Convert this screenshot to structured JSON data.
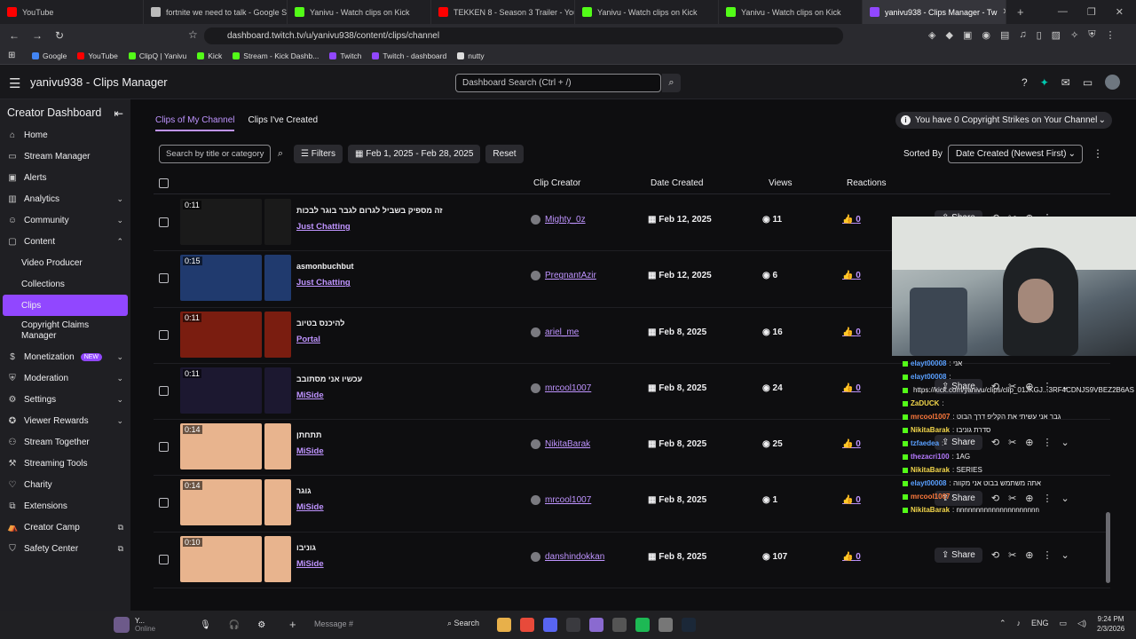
{
  "browser": {
    "tabs": [
      {
        "label": "YouTube",
        "color": "#ff0000"
      },
      {
        "label": "fortnite we need to talk - Google Se",
        "color": "#bbbbbb"
      },
      {
        "label": "Yanivu - Watch clips on Kick",
        "color": "#53fc18"
      },
      {
        "label": "TEKKEN 8 - Season 3 Trailer - YouTu",
        "color": "#ff0000"
      },
      {
        "label": "Yanivu - Watch clips on Kick",
        "color": "#53fc18"
      },
      {
        "label": "Yanivu - Watch clips on Kick",
        "color": "#53fc18"
      },
      {
        "label": "yanivu938 - Clips Manager - Tw",
        "color": "#9147ff"
      }
    ],
    "url": "dashboard.twitch.tv/u/yanivu938/content/clips/channel",
    "bookmarks": [
      {
        "label": "Google",
        "color": "#4285f4"
      },
      {
        "label": "YouTube",
        "color": "#ff0000"
      },
      {
        "label": "ClipQ | Yanivu",
        "color": "#53fc18"
      },
      {
        "label": "Kick",
        "color": "#53fc18"
      },
      {
        "label": "Stream - Kick Dashb...",
        "color": "#53fc18"
      },
      {
        "label": "Twitch",
        "color": "#9147ff"
      },
      {
        "label": "Twitch - dashboard",
        "color": "#9147ff"
      },
      {
        "label": "nutty",
        "color": "#dddddd"
      }
    ]
  },
  "header": {
    "title": "yanivu938 - Clips Manager",
    "search_placeholder": "Dashboard Search (Ctrl + /)"
  },
  "sidebar": {
    "title": "Creator Dashboard",
    "items": [
      {
        "label": "Home",
        "icon": "⌂"
      },
      {
        "label": "Stream Manager",
        "icon": "▭"
      },
      {
        "label": "Alerts",
        "icon": "▣"
      },
      {
        "label": "Analytics",
        "icon": "▥",
        "chev": "⌄"
      },
      {
        "label": "Community",
        "icon": "☺",
        "chev": "⌄"
      },
      {
        "label": "Content",
        "icon": "▢",
        "chev": "⌃"
      }
    ],
    "content_sub": [
      {
        "label": "Video Producer"
      },
      {
        "label": "Collections"
      },
      {
        "label": "Clips"
      },
      {
        "label": "Copyright Claims Manager"
      }
    ],
    "items2": [
      {
        "label": "Monetization",
        "icon": "$",
        "chev": "⌄",
        "badge": "NEW"
      },
      {
        "label": "Moderation",
        "icon": "⛨",
        "chev": "⌄"
      },
      {
        "label": "Settings",
        "icon": "⚙",
        "chev": "⌄"
      },
      {
        "label": "Viewer Rewards",
        "icon": "✪",
        "chev": "⌄"
      },
      {
        "label": "Stream Together",
        "icon": "⚇"
      },
      {
        "label": "Streaming Tools",
        "icon": "⚒"
      },
      {
        "label": "Charity",
        "icon": "♡"
      },
      {
        "label": "Extensions",
        "icon": "⧉"
      },
      {
        "label": "Creator Camp",
        "icon": "⛺",
        "ext": "⧉"
      },
      {
        "label": "Safety Center",
        "icon": "⛉",
        "ext": "⧉"
      }
    ]
  },
  "main": {
    "tabs": [
      "Clips of My Channel",
      "Clips I've Created"
    ],
    "strikes": "You have 0 Copyright Strikes on Your Channel",
    "search_placeholder": "Search by title or category",
    "filters": "Filters",
    "date_range": "Feb 1, 2025 - Feb 28, 2025",
    "reset": "Reset",
    "sorted_by": "Sorted By",
    "sort_value": "Date Created (Newest First)",
    "columns": {
      "creator": "Clip Creator",
      "date": "Date Created",
      "views": "Views",
      "reactions": "Reactions"
    },
    "share_label": "Share",
    "clips": [
      {
        "duration": "0:11",
        "title": "זה מספיק בשביל לגרום לגבר בוגר לבכות",
        "category": "Just Chatting",
        "creator": "Mighty_0z",
        "date": "Feb 12, 2025",
        "views": "11",
        "reactions": "0",
        "thumb": "#1a1a1a"
      },
      {
        "duration": "0:15",
        "title": "asmonbuchbut",
        "category": "Just Chatting",
        "creator": "PregnantAzir",
        "date": "Feb 12, 2025",
        "views": "6",
        "reactions": "0",
        "thumb": "#203a6e"
      },
      {
        "duration": "0:11",
        "title": "להיכנס בטיוב",
        "category": "Portal",
        "creator": "ariel_me",
        "date": "Feb 8, 2025",
        "views": "16",
        "reactions": "0",
        "thumb": "#7a1d10"
      },
      {
        "duration": "0:11",
        "title": "עכשיו אני מסתובב",
        "category": "MiSide",
        "creator": "mrcool1007",
        "date": "Feb 8, 2025",
        "views": "24",
        "reactions": "0",
        "thumb": "#1c1830"
      },
      {
        "duration": "0:14",
        "title": "תתחתן",
        "category": "MiSide",
        "creator": "NikitaBarak",
        "date": "Feb 8, 2025",
        "views": "25",
        "reactions": "0",
        "thumb": "#e8b48e"
      },
      {
        "duration": "0:14",
        "title": "גוגר",
        "category": "MiSide",
        "creator": "mrcool1007",
        "date": "Feb 8, 2025",
        "views": "1",
        "reactions": "0",
        "thumb": "#e8b48e"
      },
      {
        "duration": "0:10",
        "title": "גוניבו",
        "category": "MiSide",
        "creator": "danshindokkan",
        "date": "Feb 8, 2025",
        "views": "107",
        "reactions": "0",
        "thumb": "#e8b48e"
      }
    ]
  },
  "chat": [
    {
      "user": "elayt00008",
      "msg": ": אני",
      "color": "#5aa0ff"
    },
    {
      "user": "elayt00008",
      "msg": ":",
      "color": "#5aa0ff"
    },
    {
      "user": "",
      "msg": "https://kick.com/yanivu/clips/clip_01JKGJ...3RF4CDNJS9VBEZ2B6AS",
      "color": "#efeff1"
    },
    {
      "user": "ZaDUCK",
      "msg": ":",
      "color": "#f2d64b"
    },
    {
      "user": "mrcool1007",
      "msg": ": גבר אני עשיתי את הקליפ דרך הבוט",
      "color": "#ff7a3d"
    },
    {
      "user": "NikitaBarak",
      "msg": ": סדרת גוניבו",
      "color": "#f2d64b"
    },
    {
      "user": "tzfaedea",
      "msg": ":",
      "color": "#5aa0ff"
    },
    {
      "user": "thezacri100",
      "msg": ": 1AG",
      "color": "#b57aff"
    },
    {
      "user": "NikitaBarak",
      "msg": ": SERIES",
      "color": "#f2d64b"
    },
    {
      "user": "elayt00008",
      "msg": ": אתה משתמש בבוט אני מקווה",
      "color": "#5aa0ff"
    },
    {
      "user": "mrcool1007",
      "msg": ":",
      "color": "#ff7a3d"
    },
    {
      "user": "NikitaBarak",
      "msg": ": nnnnnnnnnnnnnnnnnnnnn",
      "color": "#f2d64b"
    }
  ],
  "taskbar": {
    "profile_name": "Y...",
    "profile_status": "Online",
    "message_placeholder": "Message #",
    "search": "Search",
    "lang": "ENG",
    "time": "9:24 PM",
    "date": "2/3/2026"
  }
}
